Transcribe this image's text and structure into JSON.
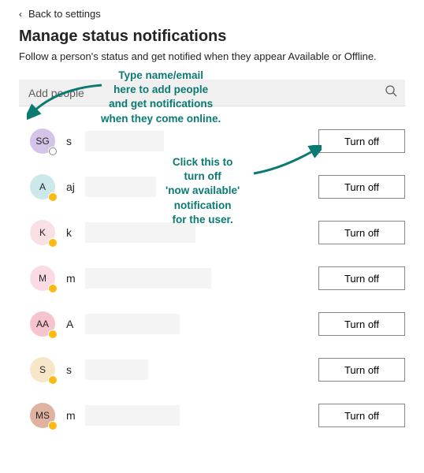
{
  "back_link": "Back to settings",
  "page_title": "Manage status notifications",
  "subtitle": "Follow a person's status and get notified when they appear Available or Offline.",
  "search": {
    "placeholder": "Add people"
  },
  "button_label": "Turn off",
  "people": [
    {
      "initials": "SG",
      "name_visible": "s",
      "avatar_bg": "#d4c4e8",
      "presence": "offline",
      "blur_w": 100
    },
    {
      "initials": "A",
      "name_visible": "aj",
      "avatar_bg": "#cde8e8",
      "presence": "away",
      "blur_w": 90
    },
    {
      "initials": "K",
      "name_visible": "k",
      "avatar_bg": "#f9e0e4",
      "presence": "away",
      "blur_w": 140
    },
    {
      "initials": "M",
      "name_visible": "m",
      "avatar_bg": "#fadbe4",
      "presence": "away",
      "blur_w": 160
    },
    {
      "initials": "AA",
      "name_visible": "A",
      "avatar_bg": "#f6c3cf",
      "presence": "away",
      "blur_w": 120
    },
    {
      "initials": "S",
      "name_visible": "s",
      "avatar_bg": "#f8e6c8",
      "presence": "away",
      "blur_w": 80
    },
    {
      "initials": "MS",
      "name_visible": "m",
      "avatar_bg": "#e0b2a0",
      "presence": "away",
      "blur_w": 120
    }
  ],
  "annotations": {
    "search_hint": "Type name/email\nhere to add people\nand get notifications\nwhen they come online.",
    "button_hint": "Click this to\nturn off\n'now available'\nnotification\nfor the user."
  }
}
